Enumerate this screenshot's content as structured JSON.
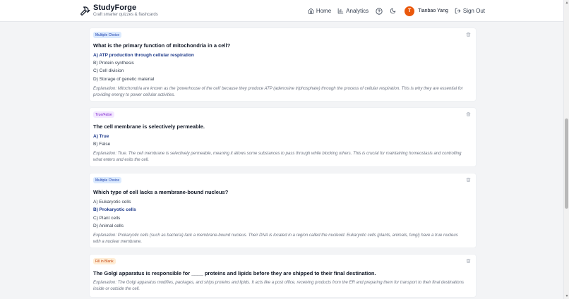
{
  "app": {
    "title": "StudyForge",
    "tagline": "Craft smarter quizzes & flashcards"
  },
  "nav": {
    "home": "Home",
    "analytics": "Analytics",
    "user_initial": "T",
    "user_name": "Tianbao Yang",
    "sign_out": "Sign Out"
  },
  "questions": [
    {
      "type": "Multiple Choice",
      "text": "What is the primary function of mitochondria in a cell?",
      "options": [
        "A) ATP production through cellular respiration",
        "B) Protein synthesis",
        "C) Cell division",
        "D) Storage of genetic material"
      ],
      "correct_index": 0,
      "explanation": "Explanation: Mitochondria are known as the 'powerhouse of the cell' because they produce ATP (adenosine triphosphate) through the process of cellular respiration. This is why they are essential for providing energy to power cellular activities."
    },
    {
      "type": "True/False",
      "text": "The cell membrane is selectively permeable.",
      "options": [
        "A) True",
        "B) False"
      ],
      "correct_index": 0,
      "explanation": "Explanation: True. The cell membrane is selectively permeable, meaning it allows some substances to pass through while blocking others. This is crucial for maintaining homeostasis and controlling what enters and exits the cell."
    },
    {
      "type": "Multiple Choice",
      "text": "Which type of cell lacks a membrane-bound nucleus?",
      "options": [
        "A) Eukaryotic cells",
        "B) Prokaryotic cells",
        "C) Plant cells",
        "D) Animal cells"
      ],
      "correct_index": 1,
      "explanation": "Explanation: Prokaryotic cells (such as bacteria) lack a membrane-bound nucleus. Their DNA is located in a region called the nucleoid. Eukaryotic cells (plants, animals, fungi) have a true nucleus with a nuclear membrane."
    },
    {
      "type": "Fill in Blank",
      "text": "The Golgi apparatus is responsible for ____ proteins and lipids before they are shipped to their final destination.",
      "options": [],
      "correct_index": -1,
      "explanation": "Explanation: The Golgi apparatus modifies, packages, and ships proteins and lipids. It acts like a post office, receiving products from the ER and preparing them for transport to their final destinations inside or outside the cell."
    }
  ],
  "colors": {
    "accent": "#1e3a8a",
    "avatar": "#ea580c",
    "mc_badge_bg": "#dbeafe",
    "tf_badge_bg": "#f3e8ff",
    "fb_badge_bg": "#ffedd5"
  }
}
